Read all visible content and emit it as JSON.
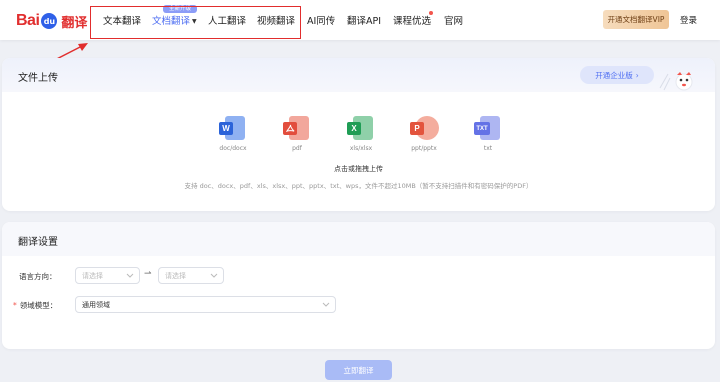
{
  "brand": {
    "bai": "Bai",
    "du": "du",
    "fanyi": "翻译"
  },
  "nav": {
    "items": [
      {
        "label": "文本翻译"
      },
      {
        "label": "文档翻译"
      },
      {
        "label": "人工翻译"
      },
      {
        "label": "视频翻译"
      },
      {
        "label": "AI同传"
      },
      {
        "label": "翻译API"
      },
      {
        "label": "课程优选"
      },
      {
        "label": "官网"
      }
    ],
    "badge": "全新升级",
    "vip_label": "开通文档翻译VIP",
    "login_label": "登录"
  },
  "upload": {
    "title": "文件上传",
    "enterprise_label": "开通企业版",
    "file_types": [
      {
        "tag": "W",
        "label": "doc/docx",
        "color": "#2b63d9"
      },
      {
        "tag": "",
        "label": "pdf",
        "color": "#e24d3d"
      },
      {
        "tag": "X",
        "label": "xls/xlsx",
        "color": "#1f9d55"
      },
      {
        "tag": "P",
        "label": "ppt/pptx",
        "color": "#e3543d"
      },
      {
        "tag": "TXT",
        "label": "txt",
        "color": "#6472e6"
      }
    ],
    "drop_title": "点击或拖拽上传",
    "drop_desc": "支持 doc、docx、pdf、xls、xlsx、ppt、pptx、txt、wps，文件不超过10MB（暂不支持扫描件和有密码保护的PDF）"
  },
  "settings": {
    "title": "翻译设置",
    "language_label": "语言方向：",
    "source_placeholder": "请选择",
    "target_placeholder": "请选择",
    "domain_label": "领域模型：",
    "domain_required_mark": "*",
    "domain_value": "通用领域"
  },
  "translate_button": "立即翻译"
}
